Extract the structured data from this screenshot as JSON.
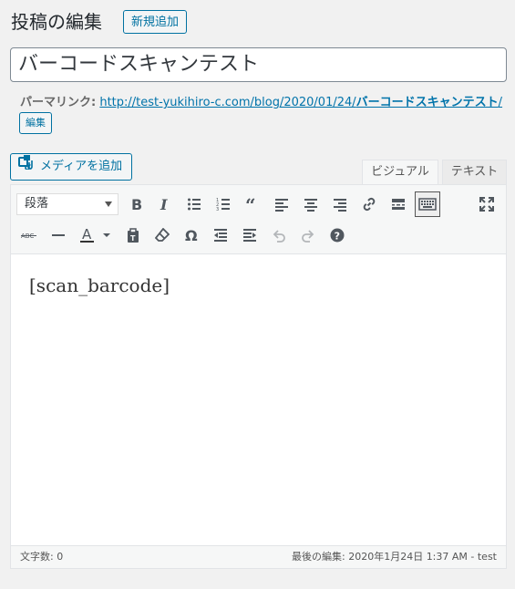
{
  "header": {
    "title": "投稿の編集",
    "add_new_label": "新規追加"
  },
  "post": {
    "title_value": "バーコードスキャンテスト"
  },
  "permalink": {
    "label": "パーマリンク:",
    "url_prefix": "http://test-yukihiro-c.com/blog/2020/01/24/",
    "slug": "バーコードスキャンテスト",
    "url_suffix": "/",
    "edit_label": "編集"
  },
  "media": {
    "add_media_label": "メディアを追加"
  },
  "tabs": {
    "visual": "ビジュアル",
    "text": "テキスト"
  },
  "toolbar": {
    "format_select_value": "段落",
    "buttons_row1": [
      "bold-icon",
      "italic-icon",
      "bulleted-list-icon",
      "numbered-list-icon",
      "blockquote-icon",
      "align-left-icon",
      "align-center-icon",
      "align-right-icon",
      "link-icon",
      "read-more-icon",
      "toolbar-toggle-icon",
      "fullscreen-icon"
    ],
    "buttons_row2": [
      "strikethrough-icon",
      "horizontal-line-icon",
      "text-color-icon",
      "paste-text-icon",
      "clear-formatting-icon",
      "special-character-icon",
      "outdent-icon",
      "indent-icon",
      "undo-icon",
      "redo-icon",
      "help-icon"
    ]
  },
  "editor": {
    "content": "[scan_barcode]"
  },
  "status": {
    "word_count": "文字数: 0",
    "last_edit": "最後の編集: 2020年1月24日 1:37 AM - test"
  },
  "colors": {
    "accent": "#0071a1",
    "link": "#0073aa",
    "background": "#f1f1f1"
  }
}
